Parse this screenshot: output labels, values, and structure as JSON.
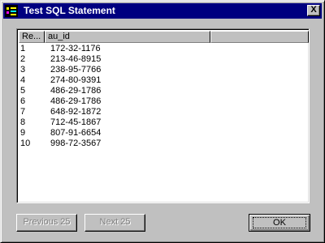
{
  "window": {
    "title": "Test SQL Statement",
    "icon": "sql-app-icon",
    "close_label": "X"
  },
  "grid": {
    "columns": [
      "Re...",
      "au_id",
      ""
    ],
    "rows": [
      {
        "n": "1",
        "au_id": "172-32-1176"
      },
      {
        "n": "2",
        "au_id": "213-46-8915"
      },
      {
        "n": "3",
        "au_id": "238-95-7766"
      },
      {
        "n": "4",
        "au_id": "274-80-9391"
      },
      {
        "n": "5",
        "au_id": "486-29-1786"
      },
      {
        "n": "6",
        "au_id": "486-29-1786"
      },
      {
        "n": "7",
        "au_id": "648-92-1872"
      },
      {
        "n": "8",
        "au_id": "712-45-1867"
      },
      {
        "n": "9",
        "au_id": "807-91-6654"
      },
      {
        "n": "10",
        "au_id": "998-72-3567"
      }
    ]
  },
  "buttons": {
    "previous": "Previous 25",
    "next": "Next 25",
    "ok": "OK"
  }
}
